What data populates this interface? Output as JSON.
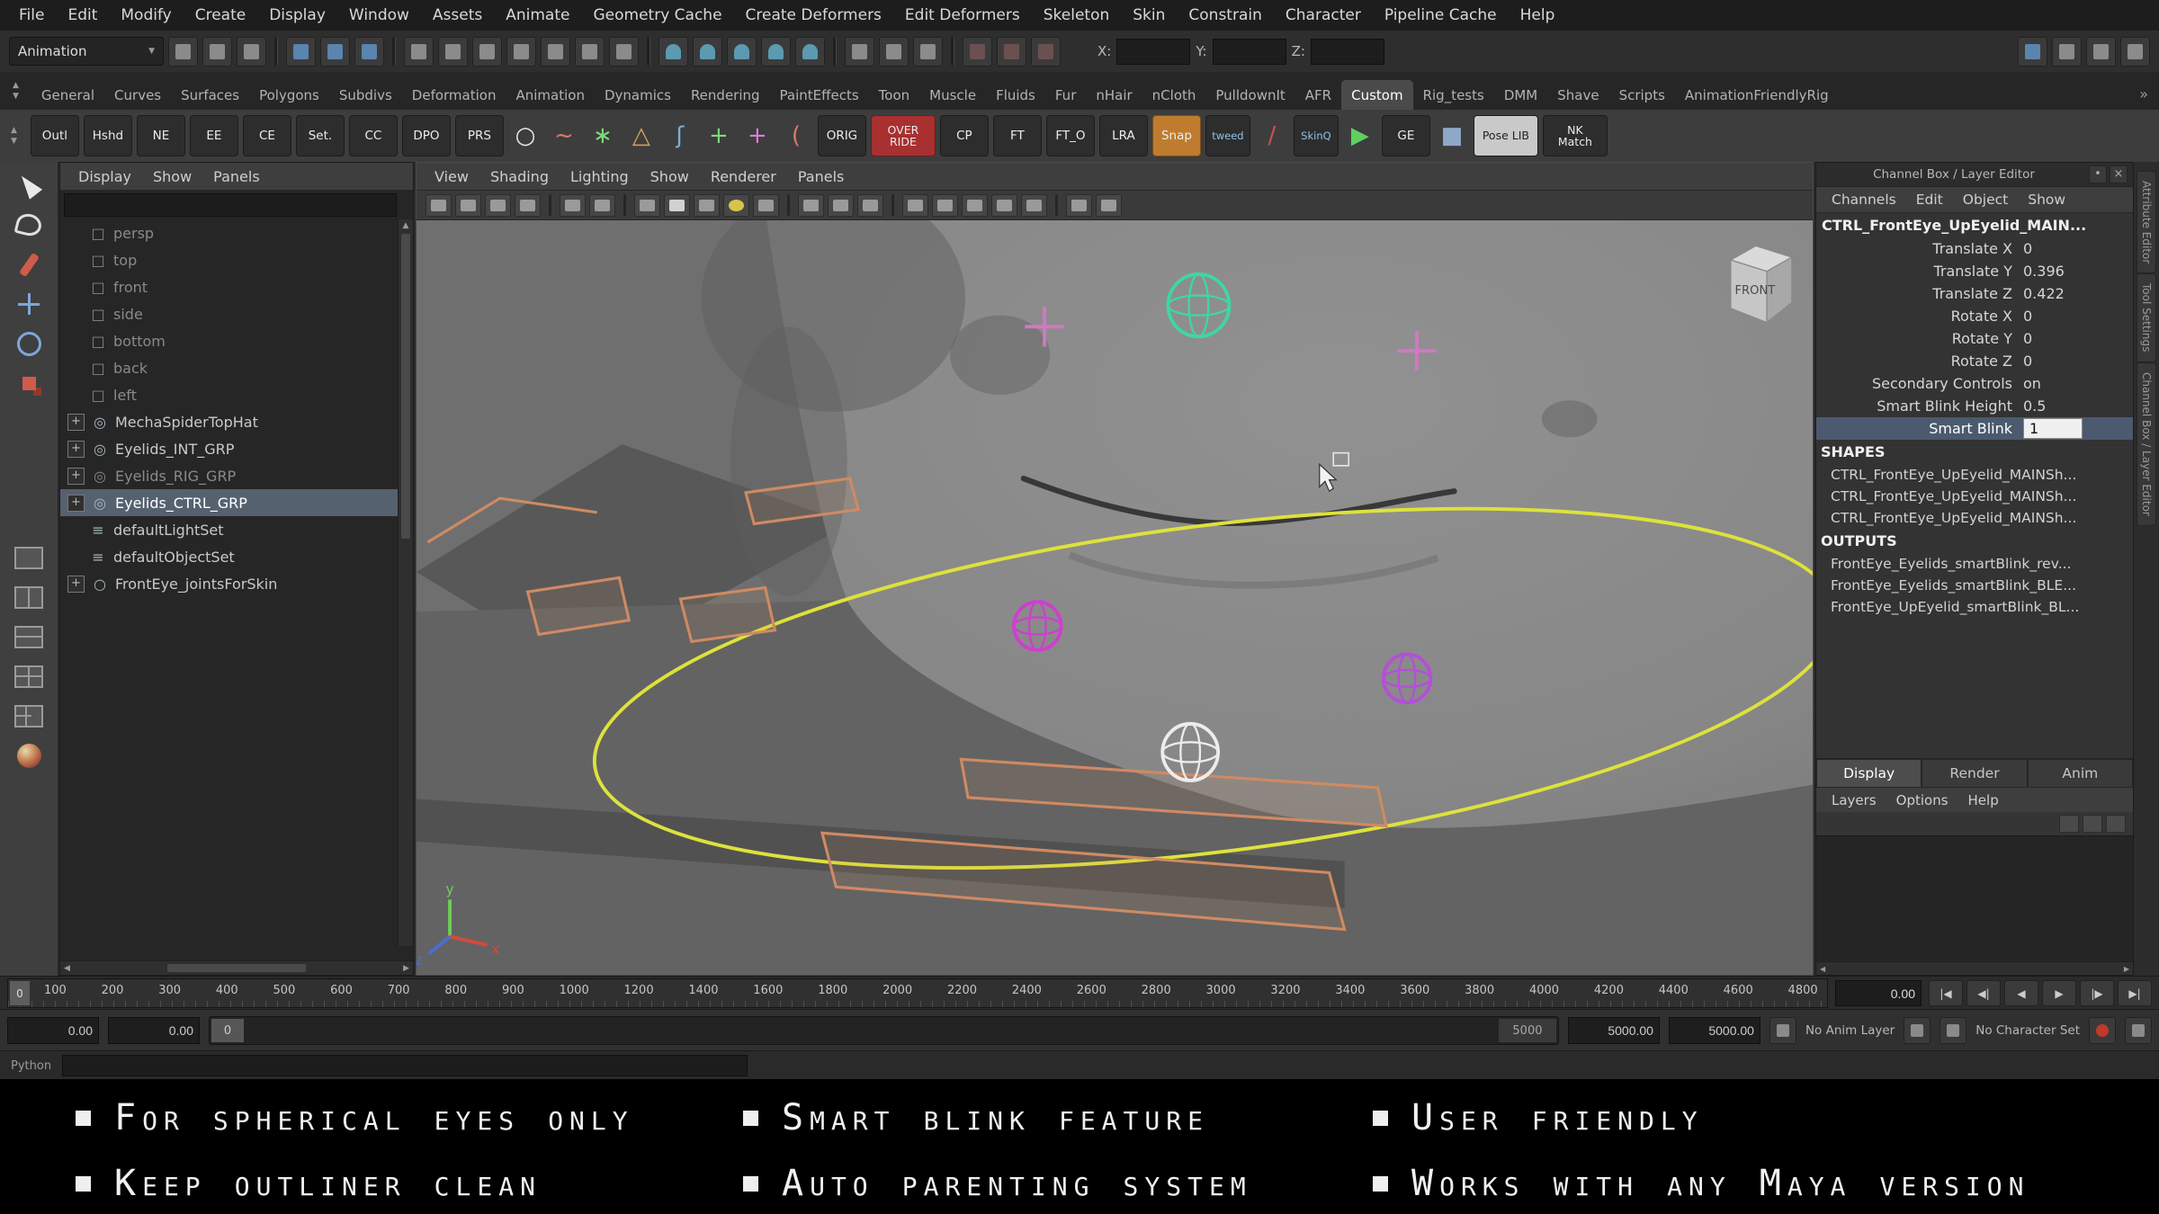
{
  "ui": {
    "up": "▲",
    "down": "▼",
    "left": "◀",
    "right": "▶",
    "dd": "▼",
    "more": "»"
  },
  "menubar": {
    "items": [
      "File",
      "Edit",
      "Modify",
      "Create",
      "Display",
      "Window",
      "Assets",
      "Animate",
      "Geometry Cache",
      "Create Deformers",
      "Edit Deformers",
      "Skeleton",
      "Skin",
      "Constrain",
      "Character",
      "Pipeline Cache",
      "Help"
    ]
  },
  "status": {
    "mode": "Animation",
    "x_label": "X:",
    "y_label": "Y:",
    "z_label": "Z:",
    "icons": [
      {
        "name": "new-scene-icon"
      },
      {
        "name": "open-scene-icon"
      },
      {
        "name": "save-scene-icon"
      },
      {
        "name": "sep",
        "cls": "sep"
      },
      {
        "name": "select-hierarchy-icon",
        "cls": "blue"
      },
      {
        "name": "select-object-icon",
        "cls": "blue"
      },
      {
        "name": "select-component-icon",
        "cls": "blue"
      },
      {
        "name": "sep",
        "cls": "sep"
      },
      {
        "name": "mask-handles-icon"
      },
      {
        "name": "mask-joints-icon"
      },
      {
        "name": "mask-curves-icon"
      },
      {
        "name": "mask-surfaces-icon"
      },
      {
        "name": "mask-deformers-icon"
      },
      {
        "name": "mask-dynamics-icon"
      },
      {
        "name": "mask-rendering-icon"
      },
      {
        "name": "sep",
        "cls": "sep"
      },
      {
        "name": "snap-to-grids-icon",
        "cls": "mag"
      },
      {
        "name": "snap-to-curves-icon",
        "cls": "mag"
      },
      {
        "name": "snap-to-points-icon",
        "cls": "mag"
      },
      {
        "name": "snap-to-planes-icon",
        "cls": "mag"
      },
      {
        "name": "make-live-icon",
        "cls": "mag"
      },
      {
        "name": "sep",
        "cls": "sep"
      },
      {
        "name": "input-connections-icon"
      },
      {
        "name": "output-connections-icon"
      },
      {
        "name": "construction-history-icon"
      },
      {
        "name": "sep",
        "cls": "sep"
      },
      {
        "name": "render-current-frame-icon",
        "cls": "dark"
      },
      {
        "name": "ipr-render-icon",
        "cls": "dark"
      },
      {
        "name": "render-settings-icon",
        "cls": "dark"
      }
    ],
    "right_icons": [
      {
        "name": "show-ui-elements-icon",
        "cls": "blue"
      },
      {
        "name": "panel-layout-single-icon"
      },
      {
        "name": "panel-layout-grid-icon"
      },
      {
        "name": "workspace-toggle-icon"
      }
    ]
  },
  "shelf": {
    "tabs": [
      {
        "label": "General"
      },
      {
        "label": "Curves"
      },
      {
        "label": "Surfaces"
      },
      {
        "label": "Polygons"
      },
      {
        "label": "Subdivs"
      },
      {
        "label": "Deformation"
      },
      {
        "label": "Animation"
      },
      {
        "label": "Dynamics"
      },
      {
        "label": "Rendering"
      },
      {
        "label": "PaintEffects"
      },
      {
        "label": "Toon"
      },
      {
        "label": "Muscle"
      },
      {
        "label": "Fluids"
      },
      {
        "label": "Fur"
      },
      {
        "label": "nHair"
      },
      {
        "label": "nCloth"
      },
      {
        "label": "PulldownIt"
      },
      {
        "label": "AFR"
      },
      {
        "label": "Custom",
        "cls": "active"
      },
      {
        "label": "Rig_tests"
      },
      {
        "label": "DMM"
      },
      {
        "label": "Shave"
      },
      {
        "label": "Scripts"
      },
      {
        "label": "AnimationFriendlyRig"
      }
    ],
    "items": [
      {
        "label": "Outl",
        "cls": "chip",
        "name": "outliner-shelf-button"
      },
      {
        "label": "Hshd",
        "cls": "chip",
        "name": "hypershade-shelf-button"
      },
      {
        "label": "NE",
        "cls": "chip",
        "name": "node-editor-shelf-button"
      },
      {
        "label": "EE",
        "cls": "chip",
        "name": "expression-editor-shelf-button"
      },
      {
        "label": "CE",
        "cls": "chip",
        "name": "component-editor-shelf-button"
      },
      {
        "label": "Set.",
        "cls": "chip",
        "name": "settings-shelf-button"
      },
      {
        "label": "CC",
        "cls": "chip",
        "name": "cc-shelf-button"
      },
      {
        "label": "DPO",
        "cls": "chip",
        "name": "dpo-shelf-button"
      },
      {
        "label": "PRS",
        "cls": "chip",
        "name": "prs-shelf-button"
      },
      {
        "glyph": "○",
        "style": "color:#e8e8e8",
        "cls": "iconitem",
        "name": "nurbs-circle-icon"
      },
      {
        "glyph": "~",
        "style": "color:#d87a6a",
        "cls": "iconitem",
        "name": "ep-curve-icon"
      },
      {
        "glyph": "∗",
        "style": "color:#7fd87f",
        "cls": "iconitem",
        "name": "star-control-icon"
      },
      {
        "glyph": "△",
        "style": "color:#d8a05e",
        "cls": "iconitem",
        "name": "pyramid-control-icon"
      },
      {
        "glyph": "ʃ",
        "style": "color:#7ab0d8",
        "cls": "iconitem",
        "name": "hook-curve-icon"
      },
      {
        "glyph": "+",
        "style": "color:#7fd87f",
        "cls": "iconitem",
        "name": "joint-tool-icon"
      },
      {
        "glyph": "+",
        "style": "color:#d87fd8",
        "cls": "iconitem",
        "name": "locator-icon"
      },
      {
        "glyph": "(",
        "style": "color:#d87a6a",
        "cls": "iconitem",
        "name": "arc-curve-icon"
      },
      {
        "label": "ORIG",
        "cls": "chip",
        "name": "orig-shelf-button"
      },
      {
        "label": "OVER RIDE",
        "cls": "chip red twoline",
        "name": "override-shelf-button"
      },
      {
        "label": "CP",
        "cls": "chip",
        "name": "cp-shelf-button"
      },
      {
        "label": "FT",
        "cls": "chip",
        "name": "ft-shelf-button"
      },
      {
        "label": "FT_O",
        "cls": "chip",
        "name": "ft-o-shelf-button"
      },
      {
        "label": "LRA",
        "cls": "chip",
        "name": "lra-shelf-button"
      },
      {
        "label": "Snap",
        "cls": "chip orange",
        "name": "snap-shelf-button"
      },
      {
        "label": "tweed",
        "cls": "mini",
        "name": "tweed-script-button"
      },
      {
        "glyph": "∕",
        "style": "color:#d05050",
        "cls": "iconitem",
        "name": "paint-skin-weights-icon"
      },
      {
        "label": "SkinQ",
        "cls": "mini",
        "name": "skin-quick-button"
      },
      {
        "glyph": "▶",
        "style": "color:#5fd05f",
        "cls": "iconitem",
        "name": "play-script-icon"
      },
      {
        "label": "GE",
        "cls": "chip",
        "name": "ge-shelf-button"
      },
      {
        "glyph": "■",
        "style": "color:#8fa8c8",
        "cls": "iconitem",
        "name": "pose-thumbnail-icon"
      },
      {
        "label": "Pose LIB",
        "cls": "chip light twoline",
        "name": "pose-library-button"
      },
      {
        "label": "NK Match",
        "cls": "chip twoline",
        "name": "nk-match-button"
      }
    ]
  },
  "toolbox": {
    "tools": [
      {
        "name": "select-tool",
        "cls": "t-select"
      },
      {
        "name": "lasso-select-tool",
        "cls": "t-lasso"
      },
      {
        "name": "paint-select-tool",
        "cls": "t-paint"
      },
      {
        "name": "move-tool",
        "cls": "t-move"
      },
      {
        "name": "rotate-tool",
        "cls": "t-rotate"
      },
      {
        "name": "scale-tool",
        "cls": "t-scale"
      },
      {
        "name": "toolbox-spacer",
        "cls": "t-space"
      },
      {
        "name": "layout-single-pane-button",
        "cls": "t-l1"
      },
      {
        "name": "layout-two-pane-button",
        "cls": "t-l2"
      },
      {
        "name": "layout-three-pane-button",
        "cls": "t-l3"
      },
      {
        "name": "layout-four-pane-button",
        "cls": "t-l4"
      },
      {
        "name": "layout-split-button",
        "cls": "t-l5"
      },
      {
        "name": "layout-persp-sphere-button",
        "cls": "t-sphere"
      }
    ]
  },
  "outliner": {
    "menus": [
      "Display",
      "Show",
      "Panels"
    ],
    "items": [
      {
        "label": "persp",
        "ic": "□",
        "cls": "dim"
      },
      {
        "label": "top",
        "ic": "□",
        "cls": "dim"
      },
      {
        "label": "front",
        "ic": "□",
        "cls": "dim"
      },
      {
        "label": "side",
        "ic": "□",
        "cls": "dim"
      },
      {
        "label": "bottom",
        "ic": "□",
        "cls": "dim"
      },
      {
        "label": "back",
        "ic": "□",
        "cls": "dim"
      },
      {
        "label": "left",
        "ic": "□",
        "cls": "dim"
      },
      {
        "label": "MechaSpiderTopHat",
        "ic": "◎",
        "exp": "+"
      },
      {
        "label": "Eyelids_INT_GRP",
        "ic": "◎",
        "exp": "+"
      },
      {
        "label": "Eyelids_RIG_GRP",
        "ic": "◎",
        "exp": "+",
        "cls": "dim"
      },
      {
        "label": "Eyelids_CTRL_GRP",
        "ic": "◎",
        "exp": "+",
        "cls": "selected"
      },
      {
        "label": "defaultLightSet",
        "ic": "≡"
      },
      {
        "label": "defaultObjectSet",
        "ic": "≡"
      },
      {
        "label": "FrontEye_jointsForSkin",
        "ic": "○",
        "exp": "+"
      }
    ]
  },
  "viewport": {
    "menus": [
      "View",
      "Shading",
      "Lighting",
      "Show",
      "Renderer",
      "Panels"
    ],
    "toolbar_icons": [
      {
        "name": "camera-select-icon"
      },
      {
        "name": "lock-camera-icon"
      },
      {
        "name": "camera-attributes-icon"
      },
      {
        "name": "bookmark-icon"
      },
      {
        "name": "sep",
        "cls": "sep"
      },
      {
        "name": "image-plane-icon"
      },
      {
        "name": "2d-pan-zoom-icon"
      },
      {
        "name": "sep",
        "cls": "sep"
      },
      {
        "name": "wireframe-icon"
      },
      {
        "name": "smooth-shade-icon",
        "cls": "on"
      },
      {
        "name": "textured-icon"
      },
      {
        "name": "use-all-lights-icon",
        "cls": "yellow"
      },
      {
        "name": "shadows-icon"
      },
      {
        "name": "sep",
        "cls": "sep"
      },
      {
        "name": "isolate-select-icon"
      },
      {
        "name": "xray-icon"
      },
      {
        "name": "wireframe-on-shaded-icon"
      },
      {
        "name": "sep",
        "cls": "sep"
      },
      {
        "name": "resolution-gate-icon"
      },
      {
        "name": "gate-mask-icon"
      },
      {
        "name": "film-gate-icon"
      },
      {
        "name": "safe-action-icon"
      },
      {
        "name": "safe-title-icon"
      },
      {
        "name": "sep",
        "cls": "sep"
      },
      {
        "name": "grease-pencil-icon"
      },
      {
        "name": "snapshot-icon"
      }
    ],
    "view_cube_label": "FRONT",
    "axis_x": "x",
    "axis_y": "y",
    "axis_z": "z"
  },
  "channel_box": {
    "title": "Channel Box / Layer Editor",
    "header_icons": [
      {
        "name": "pin-icon",
        "glyph": "•"
      },
      {
        "name": "close-icon",
        "glyph": "×"
      }
    ],
    "menus": [
      "Channels",
      "Edit",
      "Object",
      "Show"
    ],
    "object_name": "CTRL_FrontEye_UpEyelid_MAIN...",
    "attributes": [
      {
        "label": "Translate X",
        "value": "0"
      },
      {
        "label": "Translate Y",
        "value": "0.396"
      },
      {
        "label": "Translate Z",
        "value": "0.422"
      },
      {
        "label": "Rotate X",
        "value": "0"
      },
      {
        "label": "Rotate Y",
        "value": "0"
      },
      {
        "label": "Rotate Z",
        "value": "0"
      },
      {
        "label": "Secondary Controls",
        "value": "on"
      },
      {
        "label": "Smart Blink Height",
        "value": "0.5"
      },
      {
        "label": "Smart Blink",
        "value": "1",
        "cls": "selected"
      }
    ],
    "shapes_header": "SHAPES",
    "shapes": [
      "CTRL_FrontEye_UpEyelid_MAINSh...",
      "CTRL_FrontEye_UpEyelid_MAINSh...",
      "CTRL_FrontEye_UpEyelid_MAINSh..."
    ],
    "outputs_header": "OUTPUTS",
    "outputs": [
      "FrontEye_Eyelids_smartBlink_rev...",
      "FrontEye_Eyelids_smartBlink_BLE...",
      "FrontEye_UpEyelid_smartBlink_BL..."
    ],
    "layer_editor": {
      "tabs": [
        {
          "label": "Display",
          "cls": "active"
        },
        {
          "label": "Render"
        },
        {
          "label": "Anim"
        }
      ],
      "menus": [
        "Layers",
        "Options",
        "Help"
      ],
      "icons": [
        {
          "name": "new-empty-layer-icon"
        },
        {
          "name": "new-layer-from-selected-icon"
        },
        {
          "name": "delete-layer-icon"
        }
      ]
    }
  },
  "right_strip": {
    "tabs": [
      "Attribute Editor",
      "Tool Settings",
      "Channel Box / Layer Editor"
    ]
  },
  "timeline": {
    "start_label": "0",
    "labels": [
      "100",
      "200",
      "300",
      "400",
      "500",
      "600",
      "700",
      "800",
      "900",
      "1000",
      "1200",
      "1400",
      "1600",
      "1800",
      "2000",
      "2200",
      "2400",
      "2600",
      "2800",
      "3000",
      "3200",
      "3400",
      "3600",
      "3800",
      "4000",
      "4200",
      "4400",
      "4600",
      "4800"
    ],
    "current_time": "0.00",
    "playback": [
      {
        "glyph": "|◀",
        "name": "go-to-start-button"
      },
      {
        "glyph": "◀|",
        "name": "step-back-key-button"
      },
      {
        "glyph": "◀",
        "name": "step-back-frame-button"
      },
      {
        "glyph": "▶",
        "name": "play-forward-button"
      },
      {
        "glyph": "|▶",
        "name": "step-forward-frame-button"
      },
      {
        "glyph": "▶|",
        "name": "go-to-end-button"
      }
    ]
  },
  "range_slider": {
    "playback_start": "0.00",
    "anim_start": "0.00",
    "range_start": "0",
    "range_end": "5000",
    "anim_end": "5000.00",
    "playback_end": "5000.00",
    "anim_layer_label": "No Anim Layer",
    "character_set_label": "No Character Set"
  },
  "command_line": {
    "language_label": "Python"
  },
  "banner": {
    "items": [
      "For spherical eyes only",
      "Smart blink feature",
      "User friendly",
      "Keep outliner clean",
      "Auto parenting system",
      "Works with any Maya version"
    ]
  }
}
